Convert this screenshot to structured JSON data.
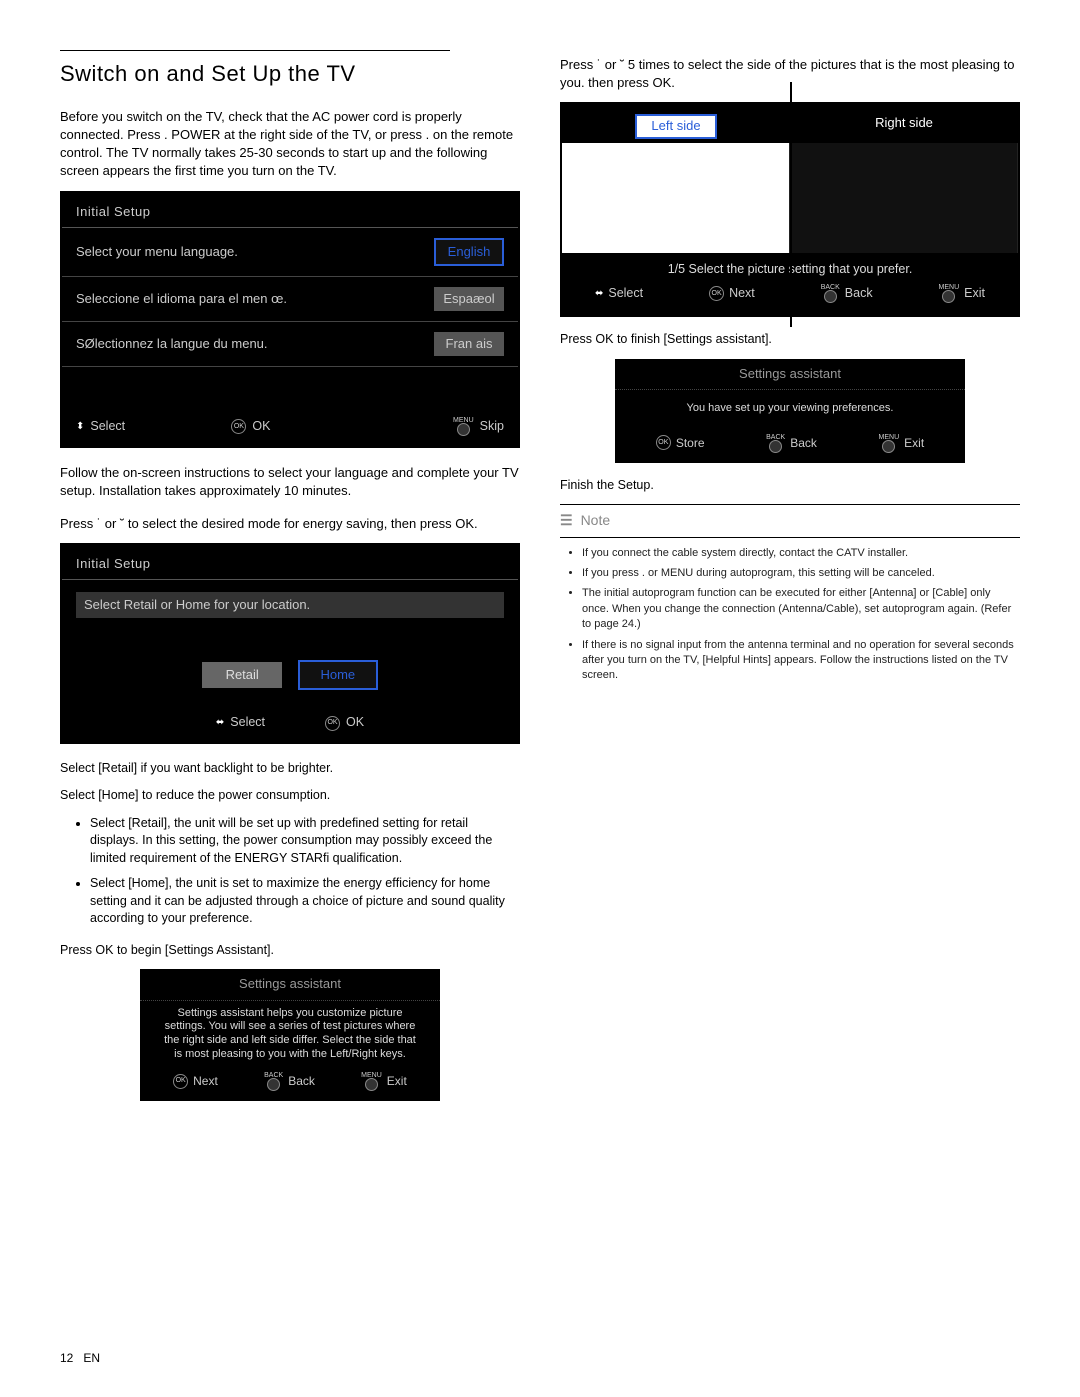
{
  "header": {
    "title": "Switch on and Set Up the TV"
  },
  "left": {
    "intro": "Before you switch on the TV, check that the AC power cord is properly connected. Press . POWER at the right side of the TV, or press . on the remote control. The TV normally takes 25-30 seconds to start up and the following screen appears the ﬁrst time you turn on the TV.",
    "panel1": {
      "title": "Initial Setup",
      "row1": "Select your menu language.",
      "row2": "Seleccione el idioma para el men œ.",
      "row3": "SØlectionnez la langue du menu.",
      "opt1": "English",
      "opt2": "Espaæol",
      "opt3": "Fran ais",
      "select": "Select",
      "ok": "OK",
      "menu_label": "MENU",
      "skip": "Skip"
    },
    "follow": "Follow the on-screen instructions to select your language and complete your TV setup. Installation takes approximately 10 minutes.",
    "press_mode": "Press ˙ or ˘ to select the desired mode for energy saving, then press OK.",
    "panel2": {
      "title": "Initial Setup",
      "prompt": "Select Retail or Home for your location.",
      "retail": "Retail",
      "home": "Home",
      "select": "Select",
      "ok": "OK"
    },
    "retail_note": "Select [Retail] if you want backlight to be brighter.",
    "home_note": "Select [Home] to reduce the power consumption.",
    "bullets": [
      "Select [Retail], the unit will be set up with predeﬁned setting for retail displays. In this setting, the power consumption may possibly exceed the limited requirement of the ENERGY STARﬁ qualiﬁcation.",
      "Select [Home], the unit is set to maximize the energy efﬁciency for home setting and it can be adjusted through a choice of picture and sound quality according to your preference."
    ],
    "press_begin": "Press OK to begin [Settings Assistant].",
    "assist1": {
      "title": "Settings assistant",
      "body": "Settings assistant helps you customize picture settings. You will see a series of test pictures where the right side and left side differ. Select the side that is most pleasing to you with the Left/Right keys.",
      "next": "Next",
      "back_lbl": "BACK",
      "back": "Back",
      "menu_lbl": "MENU",
      "exit": "Exit"
    }
  },
  "right": {
    "press_side": "Press ˙ or ˘ 5 times to select the side of the pictures that is the most pleasing to you. then press OK.",
    "preview": {
      "left_label": "Left side",
      "right_label": "Right side",
      "msg": "1/5 Select the picture setting that you prefer.",
      "select": "Select",
      "next": "Next",
      "back_lbl": "BACK",
      "back": "Back",
      "menu_lbl": "MENU",
      "exit": "Exit"
    },
    "press_finish": "Press OK to ﬁnish [Settings assistant].",
    "assist2": {
      "title": "Settings assistant",
      "body": "You have set up your viewing preferences.",
      "store": "Store",
      "back_lbl": "BACK",
      "back": "Back",
      "menu_lbl": "MENU",
      "exit": "Exit"
    },
    "finish": "Finish the Setup.",
    "note_head": "Note",
    "notes": [
      "If you connect the cable system directly, contact the CATV installer.",
      "If you press . or MENU during autoprogram, this setting will be canceled.",
      "The initial autoprogram function can be executed for either [Antenna] or [Cable] only once. When you change the connection (Antenna/Cable), set autoprogram again. (Refer to page 24.)",
      "If there is no signal input from the antenna terminal and no operation for several seconds after you turn on the TV, [Helpful Hints] appears. Follow the instructions listed on the TV screen."
    ]
  },
  "footer": {
    "page": "12",
    "lang": "EN"
  }
}
